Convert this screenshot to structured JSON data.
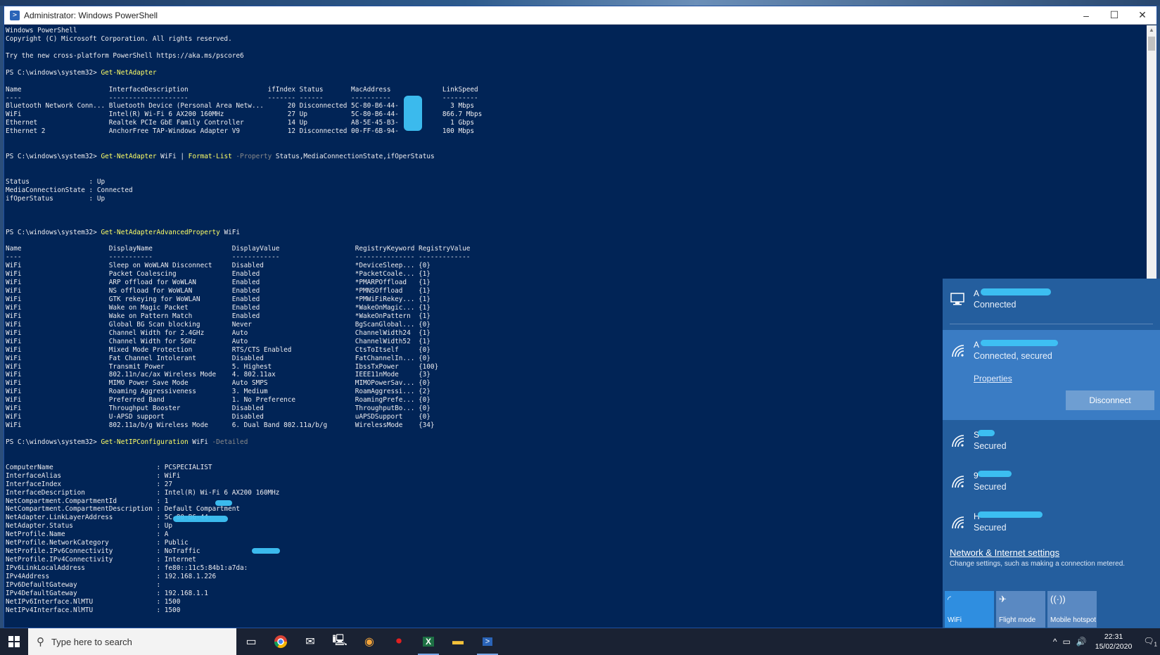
{
  "window": {
    "title": "Administrator: Windows PowerShell",
    "minimize": "–",
    "maximize": "☐",
    "close": "✕"
  },
  "console": {
    "lines": [
      {
        "t": "Windows PowerShell"
      },
      {
        "t": "Copyright (C) Microsoft Corporation. All rights reserved."
      },
      {
        "t": ""
      },
      {
        "t": "Try the new cross-platform PowerShell https://aka.ms/pscore6"
      },
      {
        "t": ""
      },
      {
        "prompt": "PS C:\\windows\\system32> ",
        "cmd": "Get-NetAdapter"
      },
      {
        "t": ""
      },
      {
        "t": "Name                      InterfaceDescription                    ifIndex Status       MacAddress             LinkSpeed"
      },
      {
        "t": "----                      --------------------                    ------- ------       ----------             ---------"
      },
      {
        "t": "Bluetooth Network Conn... Bluetooth Device (Personal Area Netw...      20 Disconnected 5C-80-B6-44-             3 Mbps"
      },
      {
        "t": "WiFi                      Intel(R) Wi-Fi 6 AX200 160MHz                27 Up           5C-80-B6-44-           866.7 Mbps"
      },
      {
        "t": "Ethernet                  Realtek PCIe GbE Family Controller           14 Up           A8-5E-45-B3-             1 Gbps"
      },
      {
        "t": "Ethernet 2                AnchorFree TAP-Windows Adapter V9            12 Disconnected 00-FF-6B-94-           100 Mbps"
      },
      {
        "t": ""
      },
      {
        "t": ""
      },
      {
        "prompt": "PS C:\\windows\\system32> ",
        "cmd": "Get-NetAdapter",
        "arg": " WiFi ",
        "pipe": "| ",
        "cmd2": "Format-List",
        "param": " -Property",
        "arg2": " Status,MediaConnectionState,ifOperStatus"
      },
      {
        "t": ""
      },
      {
        "t": ""
      },
      {
        "t": "Status               : Up"
      },
      {
        "t": "MediaConnectionState : Connected"
      },
      {
        "t": "ifOperStatus         : Up"
      },
      {
        "t": ""
      },
      {
        "t": ""
      },
      {
        "t": ""
      },
      {
        "prompt": "PS C:\\windows\\system32> ",
        "cmd": "Get-NetAdapterAdvancedProperty",
        "arg": " WiFi"
      },
      {
        "t": ""
      },
      {
        "t": "Name                      DisplayName                    DisplayValue                   RegistryKeyword RegistryValue"
      },
      {
        "t": "----                      -----------                    ------------                   --------------- -------------"
      },
      {
        "t": "WiFi                      Sleep on WoWLAN Disconnect     Disabled                       *DeviceSleep... {0}"
      },
      {
        "t": "WiFi                      Packet Coalescing              Enabled                        *PacketCoale... {1}"
      },
      {
        "t": "WiFi                      ARP offload for WoWLAN         Enabled                        *PMARPOffload   {1}"
      },
      {
        "t": "WiFi                      NS offload for WoWLAN          Enabled                        *PMNSOffload    {1}"
      },
      {
        "t": "WiFi                      GTK rekeying for WoWLAN        Enabled                        *PMWiFiRekey... {1}"
      },
      {
        "t": "WiFi                      Wake on Magic Packet           Enabled                        *WakeOnMagic... {1}"
      },
      {
        "t": "WiFi                      Wake on Pattern Match          Enabled                        *WakeOnPattern  {1}"
      },
      {
        "t": "WiFi                      Global BG Scan blocking        Never                          BgScanGlobal... {0}"
      },
      {
        "t": "WiFi                      Channel Width for 2.4GHz       Auto                           ChannelWidth24  {1}"
      },
      {
        "t": "WiFi                      Channel Width for 5GHz         Auto                           ChannelWidth52  {1}"
      },
      {
        "t": "WiFi                      Mixed Mode Protection          RTS/CTS Enabled                CtsToItself     {0}"
      },
      {
        "t": "WiFi                      Fat Channel Intolerant         Disabled                       FatChannelIn... {0}"
      },
      {
        "t": "WiFi                      Transmit Power                 5. Highest                     IbssTxPower     {100}"
      },
      {
        "t": "WiFi                      802.11n/ac/ax Wireless Mode    4. 802.11ax                    IEEE11nMode     {3}"
      },
      {
        "t": "WiFi                      MIMO Power Save Mode           Auto SMPS                      MIMOPowerSav... {0}"
      },
      {
        "t": "WiFi                      Roaming Aggressiveness         3. Medium                      RoamAggressi... {2}"
      },
      {
        "t": "WiFi                      Preferred Band                 1. No Preference               RoamingPrefe... {0}"
      },
      {
        "t": "WiFi                      Throughput Booster             Disabled                       ThroughputBo... {0}"
      },
      {
        "t": "WiFi                      U-APSD support                 Disabled                       uAPSDSupport    {0}"
      },
      {
        "t": "WiFi                      802.11a/b/g Wireless Mode      6. Dual Band 802.11a/b/g       WirelessMode    {34}"
      },
      {
        "t": ""
      },
      {
        "prompt": "PS C:\\windows\\system32> ",
        "cmd": "Get-NetIPConfiguration",
        "arg": " WiFi",
        "param": " -Detailed"
      },
      {
        "t": ""
      },
      {
        "t": ""
      },
      {
        "t": "ComputerName                          : PCSPECIALIST"
      },
      {
        "t": "InterfaceAlias                        : WiFi"
      },
      {
        "t": "InterfaceIndex                        : 27"
      },
      {
        "t": "InterfaceDescription                  : Intel(R) Wi-Fi 6 AX200 160MHz"
      },
      {
        "t": "NetCompartment.CompartmentId          : 1"
      },
      {
        "t": "NetCompartment.CompartmentDescription : Default Compartment"
      },
      {
        "t": "NetAdapter.LinkLayerAddress           : 5C-80-B6-44-"
      },
      {
        "t": "NetAdapter.Status                     : Up"
      },
      {
        "t": "NetProfile.Name                       : A"
      },
      {
        "t": "NetProfile.NetworkCategory            : Public"
      },
      {
        "t": "NetProfile.IPv6Connectivity           : NoTraffic"
      },
      {
        "t": "NetProfile.IPv4Connectivity           : Internet"
      },
      {
        "t": "IPv6LinkLocalAddress                  : fe80::11c5:84b1:a7da:"
      },
      {
        "t": "IPv4Address                           : 192.168.1.226"
      },
      {
        "t": "IPv6DefaultGateway                    :"
      },
      {
        "t": "IPv4DefaultGateway                    : 192.168.1.1"
      },
      {
        "t": "NetIPv6Interface.NlMTU                : 1500"
      },
      {
        "t": "NetIPv4Interface.NlMTU                : 1500"
      }
    ]
  },
  "flyout": {
    "wired": {
      "name": "A",
      "status": "Connected"
    },
    "active": {
      "name": "A",
      "status": "Connected, secured",
      "properties": "Properties",
      "disconnect": "Disconnect"
    },
    "others": [
      {
        "name": "S",
        "status": "Secured"
      },
      {
        "name": "9",
        "status": "Secured"
      },
      {
        "name": "H",
        "status": "Secured"
      }
    ],
    "settings_link": "Network & Internet settings",
    "settings_desc": "Change settings, such as making a connection metered.",
    "tiles": [
      {
        "label": "WiFi",
        "icon": "wifi-icon",
        "on": true
      },
      {
        "label": "Flight mode",
        "icon": "airplane-icon",
        "on": false
      },
      {
        "label": "Mobile hotspot",
        "icon": "hotspot-icon",
        "on": false
      }
    ]
  },
  "taskbar": {
    "search_placeholder": "Type here to search",
    "time": "22:31",
    "date": "15/02/2020",
    "notification_count": "1"
  },
  "colors": {
    "console_bg": "#012456",
    "command": "#ffff66",
    "flyout_bg": "#245e9e"
  }
}
